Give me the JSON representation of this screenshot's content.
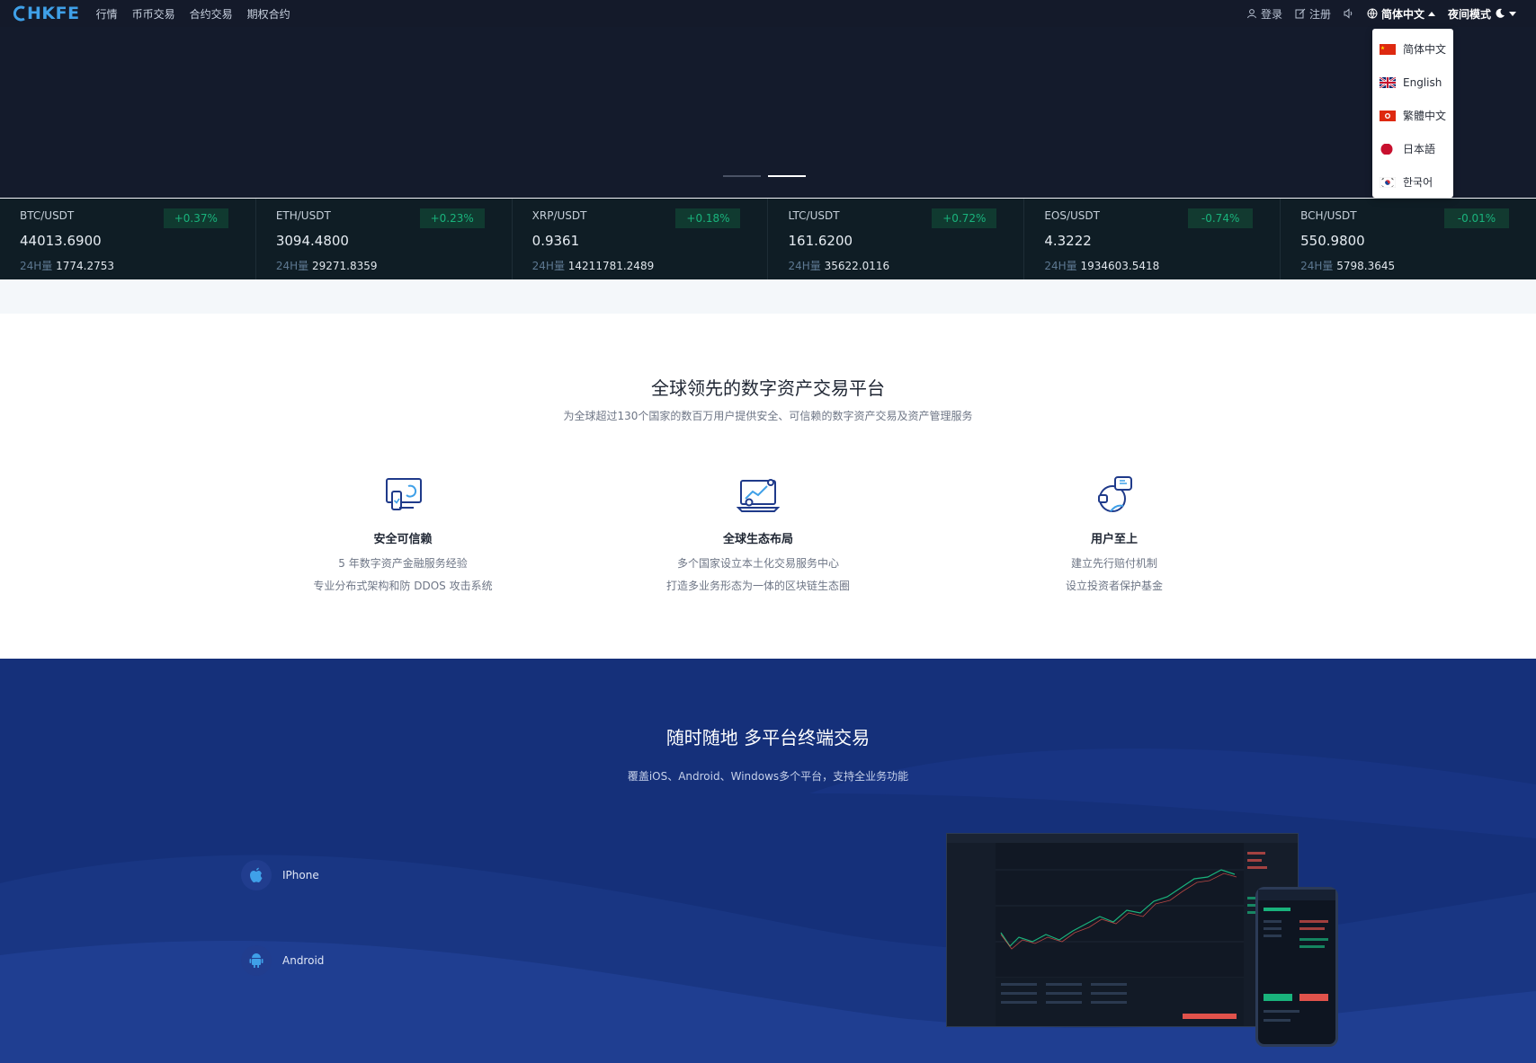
{
  "brand": {
    "logo_text": "HKFE"
  },
  "nav": {
    "links": [
      "行情",
      "币币交易",
      "合约交易",
      "期权合约"
    ],
    "login": "登录",
    "register": "注册",
    "language": "简体中文",
    "night_mode": "夜间模式"
  },
  "language_menu": [
    {
      "label": "简体中文",
      "flag": "cn-flag"
    },
    {
      "label": "English",
      "flag": "uk-flag"
    },
    {
      "label": "繁體中文",
      "flag": "hk-flag"
    },
    {
      "label": "日本語",
      "flag": "jp-flag"
    },
    {
      "label": "한국어",
      "flag": "kr-flag"
    }
  ],
  "ticker": [
    {
      "pair": "BTC/USDT",
      "change": "+0.37%",
      "price": "44013.6900",
      "vol_label": "24H量",
      "vol": "1774.2753"
    },
    {
      "pair": "ETH/USDT",
      "change": "+0.23%",
      "price": "3094.4800",
      "vol_label": "24H量",
      "vol": "29271.8359"
    },
    {
      "pair": "XRP/USDT",
      "change": "+0.18%",
      "price": "0.9361",
      "vol_label": "24H量",
      "vol": "14211781.2489"
    },
    {
      "pair": "LTC/USDT",
      "change": "+0.72%",
      "price": "161.6200",
      "vol_label": "24H量",
      "vol": "35622.0116"
    },
    {
      "pair": "EOS/USDT",
      "change": "-0.74%",
      "price": "4.3222",
      "vol_label": "24H量",
      "vol": "1934603.5418"
    },
    {
      "pair": "BCH/USDT",
      "change": "-0.01%",
      "price": "550.9800",
      "vol_label": "24H量",
      "vol": "5798.3645"
    }
  ],
  "features": {
    "title": "全球领先的数字资产交易平台",
    "subtitle": "为全球超过130个国家的数百万用户提供安全、可信赖的数字资产交易及资产管理服务",
    "items": [
      {
        "title": "安全可信赖",
        "line1": "5 年数字资产金融服务经验",
        "line2": "专业分布式架构和防 DDOS 攻击系统"
      },
      {
        "title": "全球生态布局",
        "line1": "多个国家设立本土化交易服务中心",
        "line2": "打造多业务形态为一体的区块链生态圈"
      },
      {
        "title": "用户至上",
        "line1": "建立先行赔付机制",
        "line2": "设立投资者保护基金"
      }
    ]
  },
  "platform": {
    "title": "随时随地 多平台终端交易",
    "subtitle": "覆盖iOS、Android、Windows多个平台，支持全业务功能",
    "downloads": [
      {
        "label": "IPhone",
        "icon": "apple-icon"
      },
      {
        "label": "Android",
        "icon": "android-icon"
      }
    ]
  },
  "colors": {
    "nav_bg": "#141a2a",
    "ticker_bg": "#0f1d25",
    "up_green": "#19b37c",
    "platform_bg": "#15307a",
    "accent": "#3fa0e8"
  }
}
